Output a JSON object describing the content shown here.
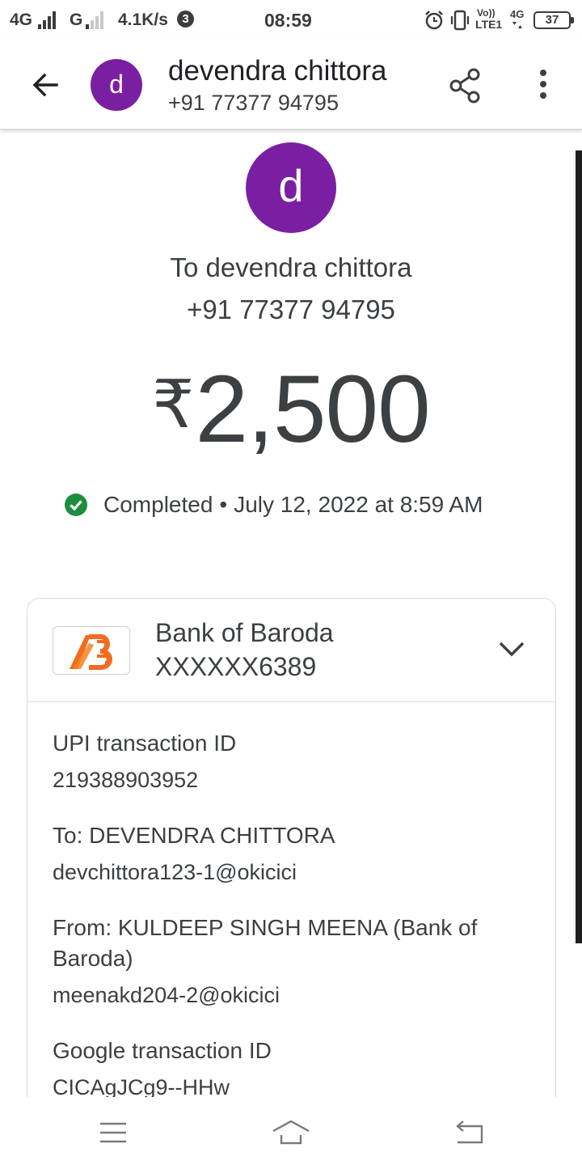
{
  "status_bar": {
    "network_1": "4G",
    "network_2": "G",
    "speed": "4.1K/s",
    "notification_count": "3",
    "time": "08:59",
    "volte_label": "Vo))",
    "lte_label": "LTE1",
    "network_3": "4G",
    "battery": "37"
  },
  "app_bar": {
    "avatar_letter": "d",
    "contact_name": "devendra chittora",
    "contact_phone": "+91 77377 94795"
  },
  "hero": {
    "avatar_letter": "d",
    "to_line": "To devendra chittora",
    "phone": "+91 77377 94795",
    "currency": "₹",
    "amount": "2,500",
    "status": "Completed",
    "separator": "•",
    "datetime": "July 12, 2022 at 8:59 AM",
    "status_color": "#1e8e3e"
  },
  "bank_card": {
    "bank_name": "Bank of Baroda",
    "account": "XXXXXX6389",
    "logo_color": "#f26b21",
    "details": [
      {
        "label": "UPI transaction ID",
        "value": "219388903952"
      },
      {
        "label": "To: DEVENDRA CHITTORA",
        "value": "devchittora123-1@okicici"
      },
      {
        "label": "From: KULDEEP SINGH MEENA (Bank of Baroda)",
        "value": "meenakd204-2@okicici"
      },
      {
        "label": "Google transaction ID",
        "value": "CICAgJCg9--HHw"
      }
    ]
  },
  "icons": {
    "back": "arrow-left-icon",
    "share": "share-icon",
    "more": "more-vert-icon",
    "expand": "chevron-down-icon",
    "status": "check-circle-icon",
    "nav_menu": "menu-icon",
    "nav_home": "home-icon",
    "nav_back": "return-icon"
  },
  "colors": {
    "avatar": "#7b1fa2",
    "text": "#3c4043"
  }
}
